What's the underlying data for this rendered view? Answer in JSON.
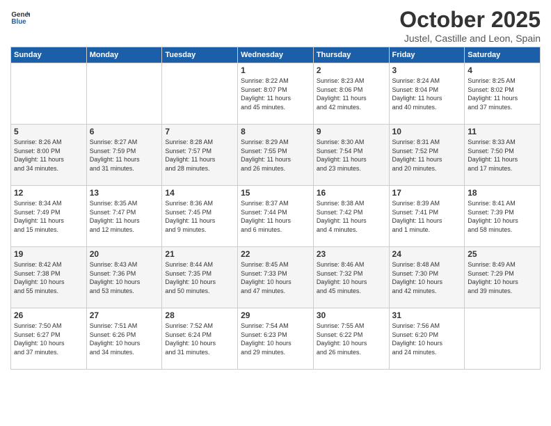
{
  "header": {
    "logo_general": "General",
    "logo_blue": "Blue",
    "month_title": "October 2025",
    "location": "Justel, Castille and Leon, Spain"
  },
  "weekdays": [
    "Sunday",
    "Monday",
    "Tuesday",
    "Wednesday",
    "Thursday",
    "Friday",
    "Saturday"
  ],
  "weeks": [
    [
      {
        "day": "",
        "info": ""
      },
      {
        "day": "",
        "info": ""
      },
      {
        "day": "",
        "info": ""
      },
      {
        "day": "1",
        "info": "Sunrise: 8:22 AM\nSunset: 8:07 PM\nDaylight: 11 hours\nand 45 minutes."
      },
      {
        "day": "2",
        "info": "Sunrise: 8:23 AM\nSunset: 8:06 PM\nDaylight: 11 hours\nand 42 minutes."
      },
      {
        "day": "3",
        "info": "Sunrise: 8:24 AM\nSunset: 8:04 PM\nDaylight: 11 hours\nand 40 minutes."
      },
      {
        "day": "4",
        "info": "Sunrise: 8:25 AM\nSunset: 8:02 PM\nDaylight: 11 hours\nand 37 minutes."
      }
    ],
    [
      {
        "day": "5",
        "info": "Sunrise: 8:26 AM\nSunset: 8:00 PM\nDaylight: 11 hours\nand 34 minutes."
      },
      {
        "day": "6",
        "info": "Sunrise: 8:27 AM\nSunset: 7:59 PM\nDaylight: 11 hours\nand 31 minutes."
      },
      {
        "day": "7",
        "info": "Sunrise: 8:28 AM\nSunset: 7:57 PM\nDaylight: 11 hours\nand 28 minutes."
      },
      {
        "day": "8",
        "info": "Sunrise: 8:29 AM\nSunset: 7:55 PM\nDaylight: 11 hours\nand 26 minutes."
      },
      {
        "day": "9",
        "info": "Sunrise: 8:30 AM\nSunset: 7:54 PM\nDaylight: 11 hours\nand 23 minutes."
      },
      {
        "day": "10",
        "info": "Sunrise: 8:31 AM\nSunset: 7:52 PM\nDaylight: 11 hours\nand 20 minutes."
      },
      {
        "day": "11",
        "info": "Sunrise: 8:33 AM\nSunset: 7:50 PM\nDaylight: 11 hours\nand 17 minutes."
      }
    ],
    [
      {
        "day": "12",
        "info": "Sunrise: 8:34 AM\nSunset: 7:49 PM\nDaylight: 11 hours\nand 15 minutes."
      },
      {
        "day": "13",
        "info": "Sunrise: 8:35 AM\nSunset: 7:47 PM\nDaylight: 11 hours\nand 12 minutes."
      },
      {
        "day": "14",
        "info": "Sunrise: 8:36 AM\nSunset: 7:45 PM\nDaylight: 11 hours\nand 9 minutes."
      },
      {
        "day": "15",
        "info": "Sunrise: 8:37 AM\nSunset: 7:44 PM\nDaylight: 11 hours\nand 6 minutes."
      },
      {
        "day": "16",
        "info": "Sunrise: 8:38 AM\nSunset: 7:42 PM\nDaylight: 11 hours\nand 4 minutes."
      },
      {
        "day": "17",
        "info": "Sunrise: 8:39 AM\nSunset: 7:41 PM\nDaylight: 11 hours\nand 1 minute."
      },
      {
        "day": "18",
        "info": "Sunrise: 8:41 AM\nSunset: 7:39 PM\nDaylight: 10 hours\nand 58 minutes."
      }
    ],
    [
      {
        "day": "19",
        "info": "Sunrise: 8:42 AM\nSunset: 7:38 PM\nDaylight: 10 hours\nand 55 minutes."
      },
      {
        "day": "20",
        "info": "Sunrise: 8:43 AM\nSunset: 7:36 PM\nDaylight: 10 hours\nand 53 minutes."
      },
      {
        "day": "21",
        "info": "Sunrise: 8:44 AM\nSunset: 7:35 PM\nDaylight: 10 hours\nand 50 minutes."
      },
      {
        "day": "22",
        "info": "Sunrise: 8:45 AM\nSunset: 7:33 PM\nDaylight: 10 hours\nand 47 minutes."
      },
      {
        "day": "23",
        "info": "Sunrise: 8:46 AM\nSunset: 7:32 PM\nDaylight: 10 hours\nand 45 minutes."
      },
      {
        "day": "24",
        "info": "Sunrise: 8:48 AM\nSunset: 7:30 PM\nDaylight: 10 hours\nand 42 minutes."
      },
      {
        "day": "25",
        "info": "Sunrise: 8:49 AM\nSunset: 7:29 PM\nDaylight: 10 hours\nand 39 minutes."
      }
    ],
    [
      {
        "day": "26",
        "info": "Sunrise: 7:50 AM\nSunset: 6:27 PM\nDaylight: 10 hours\nand 37 minutes."
      },
      {
        "day": "27",
        "info": "Sunrise: 7:51 AM\nSunset: 6:26 PM\nDaylight: 10 hours\nand 34 minutes."
      },
      {
        "day": "28",
        "info": "Sunrise: 7:52 AM\nSunset: 6:24 PM\nDaylight: 10 hours\nand 31 minutes."
      },
      {
        "day": "29",
        "info": "Sunrise: 7:54 AM\nSunset: 6:23 PM\nDaylight: 10 hours\nand 29 minutes."
      },
      {
        "day": "30",
        "info": "Sunrise: 7:55 AM\nSunset: 6:22 PM\nDaylight: 10 hours\nand 26 minutes."
      },
      {
        "day": "31",
        "info": "Sunrise: 7:56 AM\nSunset: 6:20 PM\nDaylight: 10 hours\nand 24 minutes."
      },
      {
        "day": "",
        "info": ""
      }
    ]
  ]
}
